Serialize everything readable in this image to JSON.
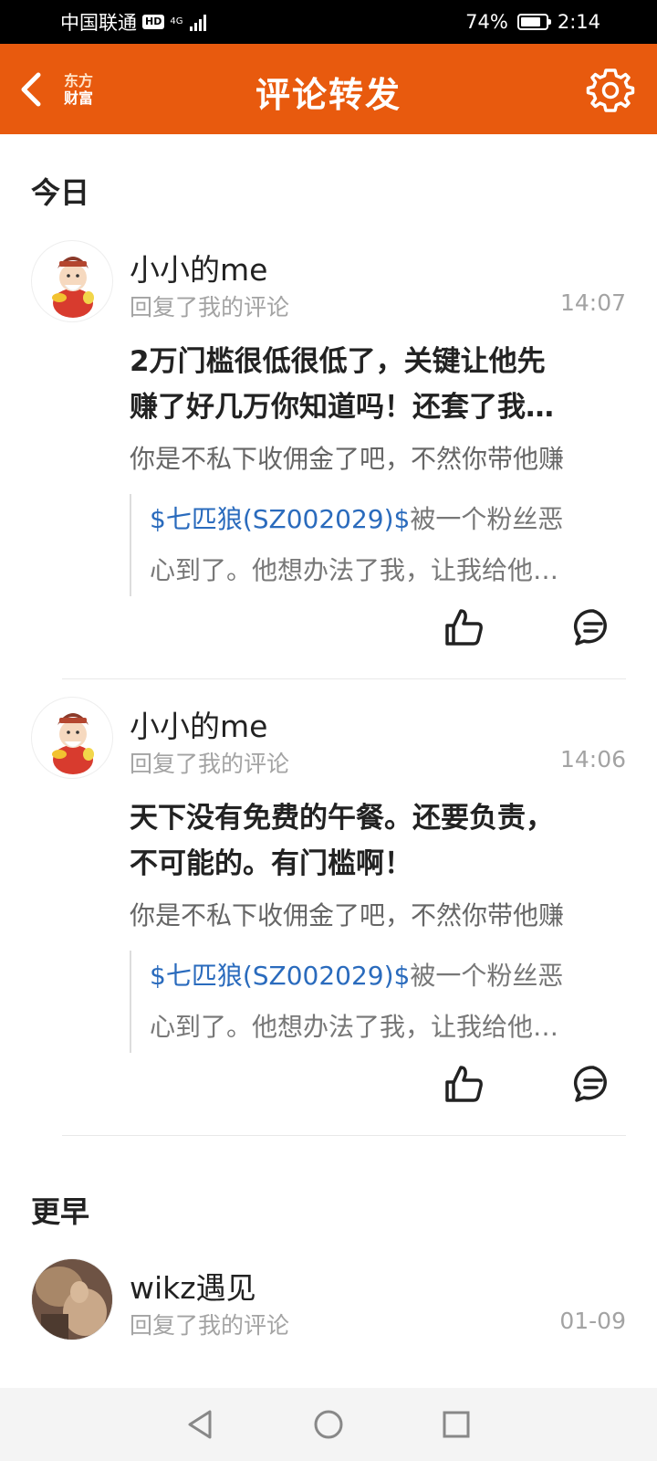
{
  "status_bar": {
    "carrier": "中国联通",
    "hd_badge": "HD",
    "network": "4G",
    "battery_percent": "74%",
    "battery_level": 0.74,
    "time": "2:14"
  },
  "header": {
    "back_icon": "chevron-left-icon",
    "logo_line1": "东方",
    "logo_line2": "财富",
    "title": "评论转发",
    "settings_icon": "gear-icon"
  },
  "colors": {
    "brand": "#e85a0e",
    "stock_link": "#2a6bbd",
    "muted": "#a3a3a3"
  },
  "sections": [
    {
      "title": "今日",
      "items": [
        {
          "username": "小小的me",
          "action": "回复了我的评论",
          "time": "14:07",
          "reply_line1": "2万门槛很低很低了，关键让他先",
          "reply_line2": "赚了好几万你知道吗！还套了我…",
          "my_comment": "你是不私下收佣金了吧，不然你带他赚",
          "quote_stock": "$七匹狼(SZ002029)$",
          "quote_line1_rest": "被一个粉丝恶",
          "quote_line2": "心到了。他想办法了我，让我给他…"
        },
        {
          "username": "小小的me",
          "action": "回复了我的评论",
          "time": "14:06",
          "reply_line1": "天下没有免费的午餐。还要负责，",
          "reply_line2": "不可能的。有门槛啊！",
          "my_comment": "你是不私下收佣金了吧，不然你带他赚",
          "quote_stock": "$七匹狼(SZ002029)$",
          "quote_line1_rest": "被一个粉丝恶",
          "quote_line2": "心到了。他想办法了我，让我给他…"
        }
      ]
    },
    {
      "title": "更早",
      "items": [
        {
          "username": "wikz遇见",
          "action": "回复了我的评论",
          "time": "01-09"
        }
      ]
    }
  ],
  "nav_bar": {
    "back": "triangle-back-icon",
    "home": "circle-home-icon",
    "recents": "square-recents-icon"
  }
}
